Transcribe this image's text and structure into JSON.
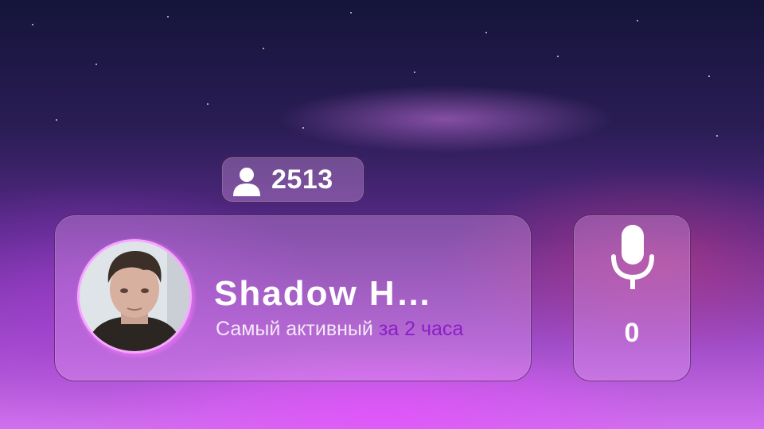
{
  "widget": {
    "viewers": {
      "icon": "user-icon",
      "count": "2513"
    },
    "top_chatter": {
      "avatar": "user-avatar-photo",
      "name": "Shadow H…",
      "subtitle_main": "Самый активный",
      "subtitle_accent": "за 2 часа"
    },
    "mic": {
      "icon": "microphone-icon",
      "count": "0"
    }
  },
  "colors": {
    "accent": "#8a1fc4",
    "card_fill": "#ebaaf5",
    "text": "#ffffff",
    "avatar_ring": "#f5a8ff"
  }
}
